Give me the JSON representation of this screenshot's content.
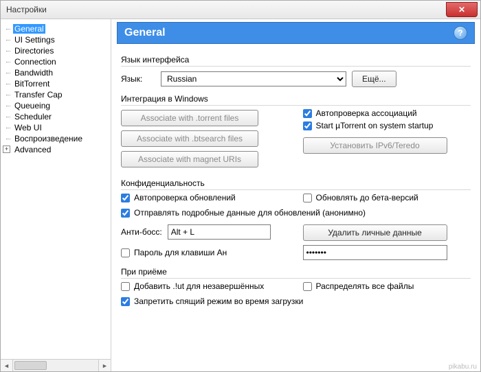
{
  "window": {
    "title": "Настройки"
  },
  "sidebar": {
    "items": [
      {
        "label": "General",
        "selected": true
      },
      {
        "label": "UI Settings"
      },
      {
        "label": "Directories"
      },
      {
        "label": "Connection"
      },
      {
        "label": "Bandwidth"
      },
      {
        "label": "BitTorrent"
      },
      {
        "label": "Transfer Cap"
      },
      {
        "label": "Queueing"
      },
      {
        "label": "Scheduler"
      },
      {
        "label": "Web UI"
      },
      {
        "label": "Воспроизведение"
      },
      {
        "label": "Advanced",
        "expandable": true
      }
    ]
  },
  "header": {
    "title": "General"
  },
  "language": {
    "group_title": "Язык интерфейса",
    "label": "Язык:",
    "selected": "Russian",
    "more_button": "Ещё..."
  },
  "integration": {
    "group_title": "Интеграция в Windows",
    "assoc_torrent": "Associate with .torrent files",
    "assoc_btsearch": "Associate with .btsearch files",
    "assoc_magnet": "Associate with magnet URIs",
    "auto_assoc": {
      "label": "Автопроверка ассоциаций",
      "checked": true
    },
    "startup": {
      "label": "Start µTorrent on system startup",
      "checked": true
    },
    "ipv6_button": "Установить IPv6/Teredo"
  },
  "privacy": {
    "group_title": "Конфиденциальность",
    "auto_update": {
      "label": "Автопроверка обновлений",
      "checked": true
    },
    "beta": {
      "label": "Обновлять до бета-версий",
      "checked": false
    },
    "send_data": {
      "label": "Отправлять подробные данные для обновлений (анонимно)",
      "checked": true
    },
    "anti_boss_label": "Анти-босс:",
    "anti_boss_value": "Alt + L",
    "clear_button": "Удалить личные данные",
    "pwd_check": {
      "label": "Пароль для клавиши Ан",
      "checked": false
    },
    "pwd_value": "•••••••"
  },
  "receive": {
    "group_title": "При приёме",
    "add_ut": {
      "label": "Добавить .!ut для незавершённых",
      "checked": false
    },
    "prealloc": {
      "label": "Распределять все файлы",
      "checked": false
    },
    "nosleep": {
      "label": "Запретить спящий режим во время загрузки",
      "checked": true
    }
  },
  "watermark": "pikabu.ru"
}
